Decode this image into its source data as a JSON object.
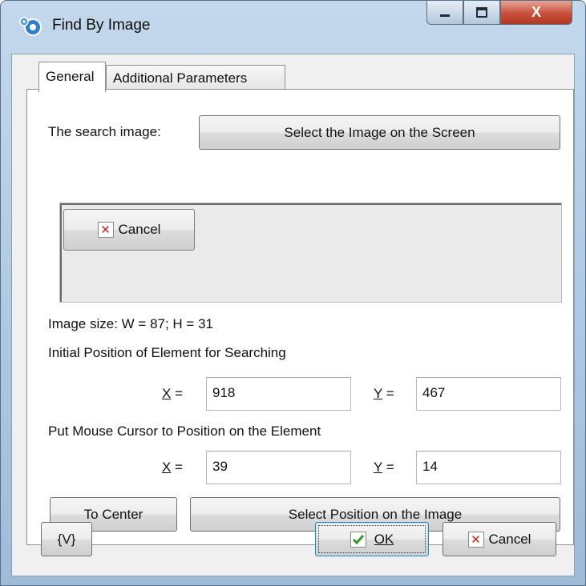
{
  "window": {
    "title": "Find By Image",
    "minimize_glyph": "▁",
    "maximize_glyph": "□",
    "close_glyph": "X"
  },
  "tabs": [
    {
      "label": "General",
      "active": true
    },
    {
      "label": "Additional Parameters",
      "active": false
    }
  ],
  "general": {
    "search_image_label": "The search image:",
    "select_image_button": "Select the Image on the Screen",
    "preview": {
      "captured_button_label": "Cancel",
      "captured_button_icon": "red-x-icon"
    },
    "image_size_text": "Image size: W = 87; H = 31",
    "initial_position_heading": "Initial Position of Element for Searching",
    "initial_position": {
      "x_label": "X",
      "x_value": "918",
      "y_label": "Y",
      "y_value": "467"
    },
    "cursor_position_heading": "Put Mouse Cursor to Position on the Element",
    "cursor_position": {
      "x_label": "X",
      "x_value": "39",
      "y_label": "Y",
      "y_value": "14"
    },
    "equals": " =",
    "to_center_button": "To Center",
    "select_position_button": "Select Position on the Image"
  },
  "footer": {
    "variables_button": "{V}",
    "ok_button": "OK",
    "ok_icon": "green-check-icon",
    "cancel_button": "Cancel",
    "cancel_icon": "red-x-icon"
  },
  "colors": {
    "title_bar": "#b8cfe6",
    "close_button": "#c7503a",
    "check_green": "#2e9a2e",
    "x_red": "#d02020"
  }
}
